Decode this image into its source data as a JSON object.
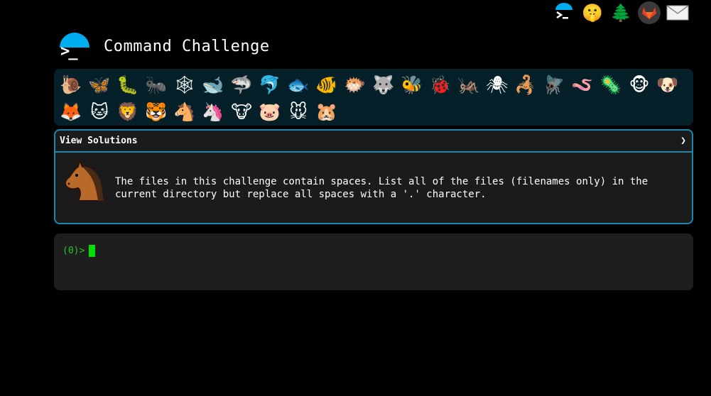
{
  "top_icons": [
    {
      "name": "command-logo-icon",
      "glyph": ">_"
    },
    {
      "name": "shushing-face-icon",
      "glyph": "🤫"
    },
    {
      "name": "tree-icon",
      "glyph": "🌲"
    },
    {
      "name": "gitlab-icon",
      "glyph": "🦊"
    },
    {
      "name": "mail-icon",
      "glyph": "✉"
    }
  ],
  "header": {
    "title": "Command Challenge",
    "logo_prompt": ">_"
  },
  "animals": [
    {
      "name": "snail",
      "glyph": "🐌"
    },
    {
      "name": "butterfly",
      "glyph": "🦋"
    },
    {
      "name": "caterpillar",
      "glyph": "🐛"
    },
    {
      "name": "ant",
      "glyph": "🐜"
    },
    {
      "name": "web",
      "glyph": "🕸"
    },
    {
      "name": "whale",
      "glyph": "🐋"
    },
    {
      "name": "shark",
      "glyph": "🦈"
    },
    {
      "name": "dolphin",
      "glyph": "🐬"
    },
    {
      "name": "fish",
      "glyph": "🐟"
    },
    {
      "name": "tropical-fish",
      "glyph": "🐠"
    },
    {
      "name": "pufferfish",
      "glyph": "🐡"
    },
    {
      "name": "wolf",
      "glyph": "🐺"
    },
    {
      "name": "bee",
      "glyph": "🐝"
    },
    {
      "name": "ladybug",
      "glyph": "🐞"
    },
    {
      "name": "cricket",
      "glyph": "🦗"
    },
    {
      "name": "spider",
      "glyph": "🕷"
    },
    {
      "name": "scorpion",
      "glyph": "🦂"
    },
    {
      "name": "fly",
      "glyph": "🪰"
    },
    {
      "name": "worm",
      "glyph": "🪱"
    },
    {
      "name": "microbe",
      "glyph": "🦠"
    },
    {
      "name": "monkey",
      "glyph": "🐵"
    },
    {
      "name": "dog",
      "glyph": "🐶"
    },
    {
      "name": "fox",
      "glyph": "🦊"
    },
    {
      "name": "cat",
      "glyph": "🐱"
    },
    {
      "name": "lion",
      "glyph": "🦁"
    },
    {
      "name": "tiger",
      "glyph": "🐯"
    },
    {
      "name": "horse",
      "glyph": "🐴"
    },
    {
      "name": "unicorn",
      "glyph": "🦄"
    },
    {
      "name": "cow",
      "glyph": "🐮"
    },
    {
      "name": "pig",
      "glyph": "🐷"
    },
    {
      "name": "mouse",
      "glyph": "🐭"
    },
    {
      "name": "hamster",
      "glyph": "🐹"
    }
  ],
  "panel": {
    "header_label": "View Solutions",
    "chevron": "❯",
    "description": "The files in this challenge contain spaces. List all of the files (filenames only) in the current directory but replace all spaces with a '.' character."
  },
  "terminal": {
    "prompt": "(0)>"
  },
  "colors": {
    "accent": "#1a88b0",
    "logo": "#00aeef",
    "prompt": "#28c828",
    "cursor": "#00e000",
    "animals_bg": "#06202a"
  }
}
